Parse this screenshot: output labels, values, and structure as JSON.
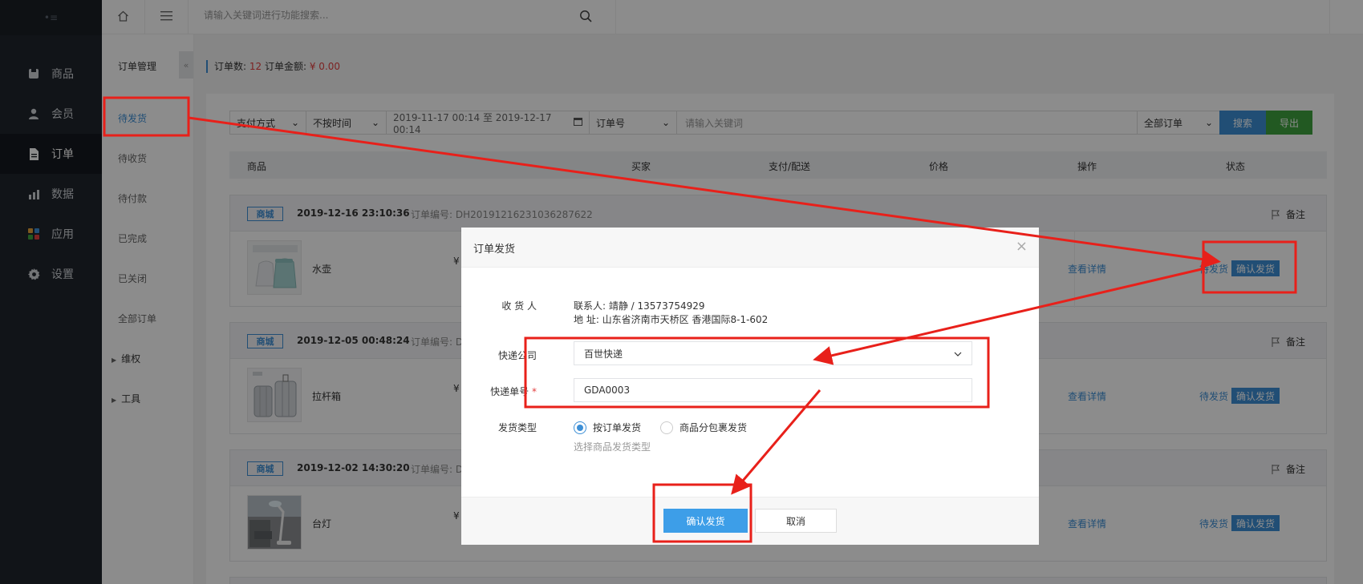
{
  "top_search": {
    "placeholder": "请输入关键词进行功能搜索..."
  },
  "sidebar": {
    "collapse_icon": "•≡",
    "items": [
      {
        "label": "商品",
        "icon": "product-icon"
      },
      {
        "label": "会员",
        "icon": "user-icon"
      },
      {
        "label": "订单",
        "icon": "order-icon"
      },
      {
        "label": "数据",
        "icon": "chart-icon"
      },
      {
        "label": "应用",
        "icon": "apps-icon"
      },
      {
        "label": "设置",
        "icon": "gear-icon"
      }
    ]
  },
  "subnav": {
    "title": "订单管理",
    "collapse": "«",
    "items": [
      "待发货",
      "待收货",
      "待付款",
      "已完成",
      "已关闭",
      "全部订单"
    ],
    "groups": [
      "维权",
      "工具"
    ]
  },
  "summary": {
    "count_label": "订单数:",
    "count": "12",
    "amount_label": "订单金额:",
    "amount": "¥ 0.00"
  },
  "filters": {
    "pay_method": "支付方式",
    "time_type": "不按时间",
    "date_range": "2019-11-17 00:14 至 2019-12-17 00:14",
    "search_field": "订单号",
    "keyword_placeholder": "请输入关键词",
    "order_scope": "全部订单",
    "search_label": "搜索",
    "export_label": "导出"
  },
  "table_header": [
    "商品",
    "买家",
    "支付/配送",
    "价格",
    "操作",
    "状态"
  ],
  "orders": [
    {
      "badge": "商城",
      "time": "2019-12-16  23:10:36",
      "order_no": "订单编号: DH20191216231036287622",
      "note": "备注",
      "product": "水壶",
      "price": "¥",
      "detail": "查看详情",
      "status": "待发货",
      "action": "确认发货"
    },
    {
      "badge": "商城",
      "time": "2019-12-05  00:48:24",
      "order_no": "订单编号: D",
      "note": "备注",
      "product": "拉杆箱",
      "price": "¥",
      "detail": "查看详情",
      "status": "待发货",
      "action": "确认发货"
    },
    {
      "badge": "商城",
      "time": "2019-12-02  14:30:20",
      "order_no": "订单编号: D",
      "note": "备注",
      "product": "台灯",
      "price": "¥",
      "detail": "查看详情",
      "status": "待发货",
      "action": "确认发货"
    }
  ],
  "modal": {
    "title": "订单发货",
    "close": "×",
    "receiver_label": "收 货 人",
    "contact": "联系人: 靖静 / 13573754929",
    "address": "地 址: 山东省济南市天桥区 香港国际8-1-602",
    "company_label": "快递公司",
    "company_value": "百世快递",
    "tracking_label": "快递单号",
    "tracking_required": "*",
    "tracking_value": "GDA0003",
    "type_label": "发货类型",
    "type_options": [
      "按订单发货",
      "商品分包裹发货"
    ],
    "type_selected": "按订单发货",
    "type_hint": "选择商品发货类型",
    "confirm_label": "确认发货",
    "cancel_label": "取消"
  },
  "colors": {
    "accent": "#3d8fd6",
    "export": "#3fa33f",
    "annotation": "#e8201a",
    "sidebar": "#20252d"
  }
}
